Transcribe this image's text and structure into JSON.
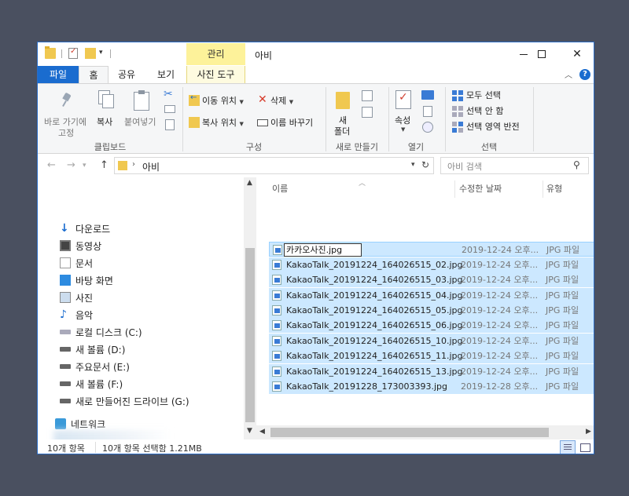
{
  "window": {
    "title": "아비",
    "manage_tab": "관리",
    "minimize_label": "–",
    "maximize_label": "☐",
    "close_label": "✕"
  },
  "tabs": {
    "file": "파일",
    "home": "홈",
    "share": "공유",
    "view": "보기",
    "picture_tools": "사진 도구"
  },
  "ribbon": {
    "clipboard": {
      "pin_label_1": "바로 가기에",
      "pin_label_2": "고정",
      "copy": "복사",
      "paste": "붙여넣기",
      "group": "클립보드"
    },
    "organize": {
      "move_to": "이동 위치",
      "copy_to": "복사 위치",
      "delete": "삭제",
      "rename": "이름 바꾸기",
      "group": "구성"
    },
    "new": {
      "new_folder_1": "새",
      "new_folder_2": "폴더",
      "group": "새로 만들기"
    },
    "open": {
      "properties": "속성",
      "group": "열기"
    },
    "select": {
      "select_all": "모두 선택",
      "select_none": "선택 안 함",
      "invert": "선택 영역 반전",
      "group": "선택"
    }
  },
  "address": {
    "path": "아비",
    "search_placeholder": "아비 검색"
  },
  "nav": {
    "items": [
      {
        "label": "다운로드",
        "icon": "download-icon"
      },
      {
        "label": "동영상",
        "icon": "video-icon"
      },
      {
        "label": "문서",
        "icon": "document-icon"
      },
      {
        "label": "바탕 화면",
        "icon": "desktop-icon"
      },
      {
        "label": "사진",
        "icon": "picture-icon"
      },
      {
        "label": "음악",
        "icon": "music-icon"
      },
      {
        "label": "로컬 디스크 (C:)",
        "icon": "drive-icon"
      },
      {
        "label": "새 볼륨 (D:)",
        "icon": "drive-icon"
      },
      {
        "label": "주요문서 (E:)",
        "icon": "drive-icon"
      },
      {
        "label": "새 볼륨 (F:)",
        "icon": "drive-icon"
      },
      {
        "label": "새로 만들어진 드라이브 (G:)",
        "icon": "drive-icon"
      },
      {
        "label": "네트워크",
        "icon": "network-icon"
      }
    ]
  },
  "columns": {
    "name": "이름",
    "modified": "수정한 날짜",
    "type": "유형"
  },
  "files": [
    {
      "name": "카카오사진.jpg",
      "date": "2019-12-24 오후...",
      "type": "JPG 파일"
    },
    {
      "name": "KakaoTalk_20191224_164026515_02.jpg",
      "date": "2019-12-24 오후...",
      "type": "JPG 파일"
    },
    {
      "name": "KakaoTalk_20191224_164026515_03.jpg",
      "date": "2019-12-24 오후...",
      "type": "JPG 파일"
    },
    {
      "name": "KakaoTalk_20191224_164026515_04.jpg",
      "date": "2019-12-24 오후...",
      "type": "JPG 파일"
    },
    {
      "name": "KakaoTalk_20191224_164026515_05.jpg",
      "date": "2019-12-24 오후...",
      "type": "JPG 파일"
    },
    {
      "name": "KakaoTalk_20191224_164026515_06.jpg",
      "date": "2019-12-24 오후...",
      "type": "JPG 파일"
    },
    {
      "name": "KakaoTalk_20191224_164026515_10.jpg",
      "date": "2019-12-24 오후...",
      "type": "JPG 파일"
    },
    {
      "name": "KakaoTalk_20191224_164026515_11.jpg",
      "date": "2019-12-24 오후...",
      "type": "JPG 파일"
    },
    {
      "name": "KakaoTalk_20191224_164026515_13.jpg",
      "date": "2019-12-24 오후...",
      "type": "JPG 파일"
    },
    {
      "name": "KakaoTalk_20191228_173003393.jpg",
      "date": "2019-12-28 오후...",
      "type": "JPG 파일"
    }
  ],
  "status": {
    "count": "10개 항목",
    "selection": "10개 항목 선택함 1.21MB"
  },
  "colors": {
    "accent": "#1a6ccf",
    "selection": "#cce8ff",
    "manage_tab": "#fdf29a",
    "background": "#4a5060"
  }
}
